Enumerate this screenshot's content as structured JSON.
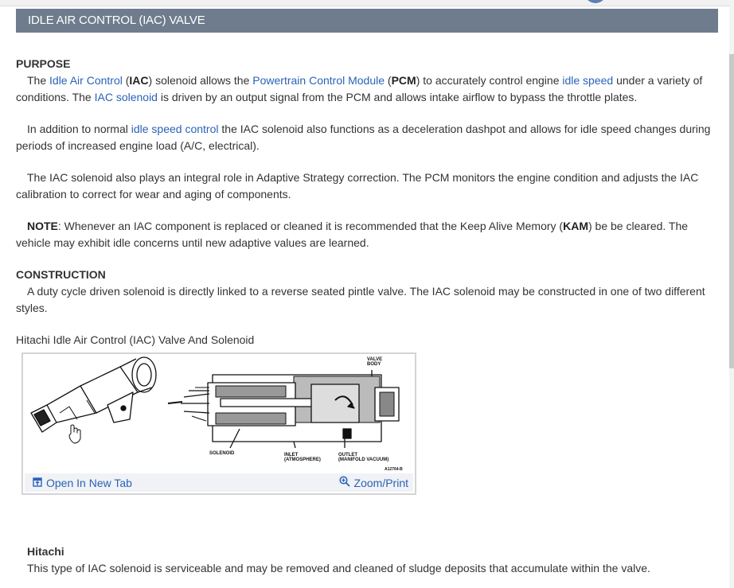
{
  "header": {
    "title": "IDLE AIR CONTROL (IAC) VALVE"
  },
  "purpose": {
    "heading": "PURPOSE",
    "p1": {
      "t1": "The ",
      "l1": "Idle Air Control",
      "t2": " (",
      "b1": "IAC",
      "t3": ") solenoid allows the ",
      "l2": "Powertrain Control Module",
      "t4": " (",
      "b2": "PCM",
      "t5": ") to accurately control engine ",
      "l3": "idle speed",
      "t6": " under a variety of conditions. The ",
      "l4": "IAC solenoid",
      "t7": " is driven by an output signal from the PCM and allows intake airflow to bypass the throttle plates."
    },
    "p2": {
      "t1": "In addition to normal ",
      "l1": "idle speed control",
      "t2": " the IAC solenoid also functions as a deceleration dashpot and allows for idle speed changes during periods of increased engine load (A/C, electrical)."
    },
    "p3": "The IAC solenoid also plays an integral role in Adaptive Strategy correction. The PCM monitors the engine condition and adjusts the IAC calibration to correct for wear and aging of components.",
    "note": {
      "label": "NOTE",
      "t1": ": Whenever an IAC component is replaced or cleaned it is recommended that the Keep Alive Memory (",
      "b1": "KAM",
      "t2": ") be be cleared. The vehicle may exhibit idle concerns until new adaptive values are learned."
    }
  },
  "construction": {
    "heading": "CONSTRUCTION",
    "p1": "A duty cycle driven solenoid is directly linked to a reverse seated pintle valve. The IAC solenoid may be constructed in one of two different styles."
  },
  "figure": {
    "caption": "Hitachi Idle Air Control (IAC) Valve And Solenoid",
    "labels": {
      "valve_body_1": "VALVE",
      "valve_body_2": "BODY",
      "solenoid": "SOLENOID",
      "inlet_1": "INLET",
      "inlet_2": "(ATMOSPHERE)",
      "outlet_1": "OUTLET",
      "outlet_2": "(MANIFOLD VACUUM)",
      "ref": "A12764-B"
    },
    "open_tab_label": "Open In New Tab",
    "zoom_label": "Zoom/Print"
  },
  "hitachi": {
    "heading": "Hitachi",
    "p1": "This type of IAC solenoid is serviceable and may be removed and cleaned of sludge deposits that accumulate within the valve."
  },
  "icons": {
    "open_tab": "open-in-new-tab-icon",
    "zoom": "zoom-in-icon",
    "cursor": "hand-cursor-icon"
  },
  "colors": {
    "title_bar": "#6e7c8d",
    "link": "#2a62b8"
  }
}
